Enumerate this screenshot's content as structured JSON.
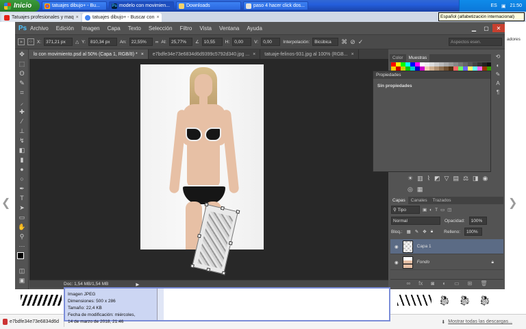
{
  "taskbar": {
    "start_label": "Inicio",
    "buttons": [
      {
        "label": "tatuajes dibujo+ - Bu..."
      },
      {
        "label": "modelo con movimien..."
      },
      {
        "label": "Downloads"
      },
      {
        "label": "paso 4 hacer click dos..."
      }
    ],
    "tray_lang": "ES",
    "clock": "21:50",
    "tooltip": "Español (alfabetización internacional)"
  },
  "chrome": {
    "tabs": [
      {
        "label": "Tatuajes profesionales y maq"
      },
      {
        "label": "tatuajes dibujo+ - Buscar con"
      }
    ],
    "side_label": "adores"
  },
  "photoshop": {
    "logo": "Ps",
    "menu": [
      "Archivo",
      "Edición",
      "Imagen",
      "Capa",
      "Texto",
      "Selección",
      "Filtro",
      "Vista",
      "Ventana",
      "Ayuda"
    ],
    "options": {
      "x_label": "X:",
      "x_value": "371,21 px",
      "y_label": "Y:",
      "y_value": "810,34 px",
      "w_label": "An:",
      "w_value": "22,55%",
      "h_label": "Al:",
      "h_value": "25,77%",
      "angle_value": "10,55",
      "hskew_label": "H:",
      "hskew_value": "0,00",
      "vskew_label": "V:",
      "vskew_value": "0,00",
      "interp_label": "Interpolación:",
      "interp_value": "Bicúbica",
      "search_placeholder": "Aspectos esen."
    },
    "doc_tabs": [
      {
        "label": "lo con movimiento.psd al 50% (Capa 1, RGB/8) *"
      },
      {
        "label": "e7bdfe34e73e6834d6d9399c5792d340.jpg ..."
      },
      {
        "label": "tatuaje-felinos-931.jpg al 100% (RGB..."
      }
    ],
    "status": "Doc: 1,54 MB/1,54 MB",
    "panels": {
      "color_tab": "Color",
      "swatches_tab": "Muestras",
      "properties_title": "Propiedades",
      "properties_body": "Sin propiedades",
      "layers_tab": "Capas",
      "channels_tab": "Canales",
      "paths_tab": "Trazados",
      "filter_label": "Tipo",
      "blend_mode": "Normal",
      "opacity_label": "Opacidad:",
      "opacity_value": "100%",
      "lock_label": "Bloq.:",
      "fill_label": "Relleno:",
      "fill_value": "100%",
      "layers": [
        {
          "name": "Capa 1"
        },
        {
          "name": "Fondo"
        }
      ]
    },
    "swatch_colors": [
      "#ff0000",
      "#ffff00",
      "#00ff00",
      "#00ffff",
      "#0000ff",
      "#ff00ff",
      "#ffffff",
      "#eeeeee",
      "#dddddd",
      "#cccccc",
      "#bbbbbb",
      "#aaaaaa",
      "#999999",
      "#888888",
      "#777777",
      "#666666",
      "#555555",
      "#444444",
      "#333333",
      "#222222",
      "#111111",
      "#000000",
      "#ff8800",
      "#ffcc00",
      "#cc0000",
      "#cccc00",
      "#00cc00",
      "#00cccc",
      "#0000cc",
      "#cc00cc",
      "#f0d0b0",
      "#d0b090",
      "#b09070",
      "#907050",
      "#705030",
      "#503010",
      "#ff6666",
      "#66ff66",
      "#6666ff",
      "#ffff66",
      "#66ffff",
      "#ff66ff",
      "#993300",
      "#339900",
      "#003399",
      "#990033",
      "#ff9966",
      "#9966ff"
    ]
  },
  "file_info": {
    "type": "Imagen JPEG",
    "dimensions": "Dimensiones: 500 x 286",
    "size": "Tamaño: 22,4 KB",
    "modified": "Fecha de modificación: miércoles,",
    "modified2": "14 de marzo de 2018, 21:46"
  },
  "downloads": {
    "item": "e7bdfe34e73e6834d6d",
    "show_all": "Mostrar todas las descargas..."
  }
}
